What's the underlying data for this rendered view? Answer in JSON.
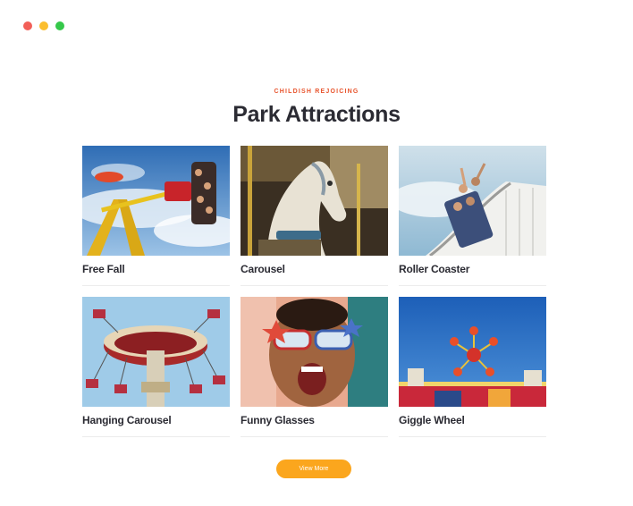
{
  "colors": {
    "dot_red": "#f25f58",
    "dot_yellow": "#fbbe2e",
    "dot_green": "#35c84a",
    "accent": "#e8552e",
    "button": "#fba61d"
  },
  "section": {
    "eyebrow": "CHILDISH REJOICING",
    "title": "Park Attractions"
  },
  "attractions": [
    {
      "label": "Free Fall"
    },
    {
      "label": "Carousel"
    },
    {
      "label": "Roller Coaster"
    },
    {
      "label": "Hanging Carousel"
    },
    {
      "label": "Funny Glasses"
    },
    {
      "label": "Giggle Wheel"
    }
  ],
  "button": {
    "label": "View More"
  }
}
